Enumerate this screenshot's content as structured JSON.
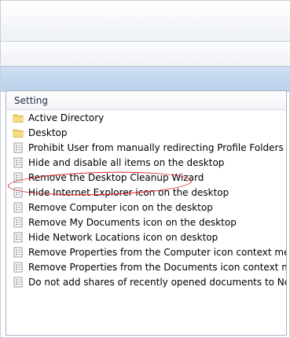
{
  "list": {
    "column_header": "Setting",
    "items": [
      {
        "label": "Active Directory",
        "icon": "folder-icon"
      },
      {
        "label": "Desktop",
        "icon": "folder-icon"
      },
      {
        "label": "Prohibit User from manually redirecting Profile Folders",
        "icon": "policy-setting-icon"
      },
      {
        "label": "Hide and disable all items on the desktop",
        "icon": "policy-setting-icon"
      },
      {
        "label": "Remove the Desktop Cleanup Wizard",
        "icon": "policy-setting-icon"
      },
      {
        "label": "Hide Internet Explorer icon on the desktop",
        "icon": "policy-setting-icon"
      },
      {
        "label": "Remove Computer icon on the desktop",
        "icon": "policy-setting-icon"
      },
      {
        "label": "Remove My Documents icon on the desktop",
        "icon": "policy-setting-icon"
      },
      {
        "label": "Hide Network Locations icon on desktop",
        "icon": "policy-setting-icon"
      },
      {
        "label": "Remove Properties from the Computer icon context menu",
        "icon": "policy-setting-icon"
      },
      {
        "label": "Remove Properties from the Documents icon context menu",
        "icon": "policy-setting-icon"
      },
      {
        "label": "Do not add shares of recently opened documents to Networ...",
        "icon": "policy-setting-icon"
      }
    ]
  },
  "colors": {
    "highlight": "#e02222",
    "folder": "#f2cf62"
  }
}
